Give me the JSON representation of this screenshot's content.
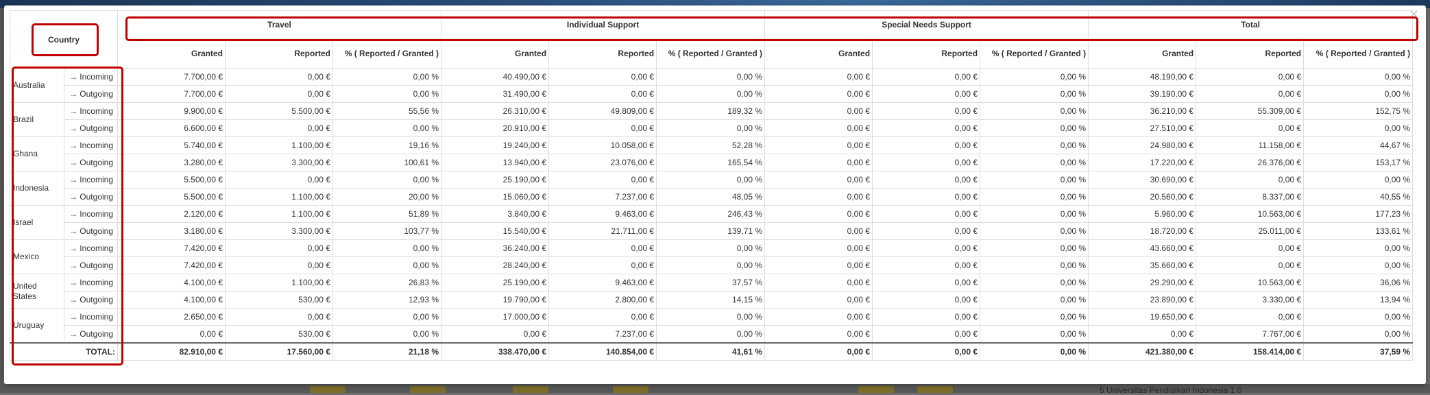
{
  "dialog": {
    "close_icon": "close-icon"
  },
  "table": {
    "corner_label": "Country",
    "groups": [
      "Travel",
      "Individual Support",
      "Special Needs Support",
      "Total"
    ],
    "subcols": [
      "Granted",
      "Reported",
      "% ( Reported / Granted )"
    ],
    "countries": [
      {
        "name": "Australia",
        "rows": [
          {
            "dir": "Incoming",
            "arrow": "right",
            "vals": [
              "7.700,00 €",
              "0,00 €",
              "0,00 %",
              "40.490,00 €",
              "0,00 €",
              "0,00 %",
              "0,00 €",
              "0,00 €",
              "0,00 %",
              "48.190,00 €",
              "0,00 €",
              "0,00 %"
            ]
          },
          {
            "dir": "Outgoing",
            "arrow": "right",
            "vals": [
              "7.700,00 €",
              "0,00 €",
              "0,00 %",
              "31.490,00 €",
              "0,00 €",
              "0,00 %",
              "0,00 €",
              "0,00 €",
              "0,00 %",
              "39.190,00 €",
              "0,00 €",
              "0,00 %"
            ]
          }
        ]
      },
      {
        "name": "Brazil",
        "rows": [
          {
            "dir": "Incoming",
            "arrow": "right",
            "vals": [
              "9.900,00 €",
              "5.500,00 €",
              "55,56 %",
              "26.310,00 €",
              "49.809,00 €",
              "189,32 %",
              "0,00 €",
              "0,00 €",
              "0,00 %",
              "36.210,00 €",
              "55.309,00 €",
              "152,75 %"
            ]
          },
          {
            "dir": "Outgoing",
            "arrow": "right",
            "vals": [
              "6.600,00 €",
              "0,00 €",
              "0,00 %",
              "20.910,00 €",
              "0,00 €",
              "0,00 %",
              "0,00 €",
              "0,00 €",
              "0,00 %",
              "27.510,00 €",
              "0,00 €",
              "0,00 %"
            ]
          }
        ]
      },
      {
        "name": "Ghana",
        "rows": [
          {
            "dir": "Incoming",
            "arrow": "right",
            "vals": [
              "5.740,00 €",
              "1.100,00 €",
              "19,16 %",
              "19.240,00 €",
              "10.058,00 €",
              "52,28 %",
              "0,00 €",
              "0,00 €",
              "0,00 %",
              "24.980,00 €",
              "11.158,00 €",
              "44,67 %"
            ]
          },
          {
            "dir": "Outgoing",
            "arrow": "right",
            "vals": [
              "3.280,00 €",
              "3.300,00 €",
              "100,61 %",
              "13.940,00 €",
              "23.076,00 €",
              "165,54 %",
              "0,00 €",
              "0,00 €",
              "0,00 %",
              "17.220,00 €",
              "26.376,00 €",
              "153,17 %"
            ]
          }
        ]
      },
      {
        "name": "Indonesia",
        "rows": [
          {
            "dir": "Incoming",
            "arrow": "right",
            "vals": [
              "5.500,00 €",
              "0,00 €",
              "0,00 %",
              "25.190,00 €",
              "0,00 €",
              "0,00 %",
              "0,00 €",
              "0,00 €",
              "0,00 %",
              "30.690,00 €",
              "0,00 €",
              "0,00 %"
            ]
          },
          {
            "dir": "Outgoing",
            "arrow": "right",
            "vals": [
              "5.500,00 €",
              "1.100,00 €",
              "20,00 %",
              "15.060,00 €",
              "7.237,00 €",
              "48,05 %",
              "0,00 €",
              "0,00 €",
              "0,00 %",
              "20.560,00 €",
              "8.337,00 €",
              "40,55 %"
            ]
          }
        ]
      },
      {
        "name": "Israel",
        "rows": [
          {
            "dir": "Incoming",
            "arrow": "right",
            "vals": [
              "2.120,00 €",
              "1.100,00 €",
              "51,89 %",
              "3.840,00 €",
              "9.463,00 €",
              "246,43 %",
              "0,00 €",
              "0,00 €",
              "0,00 %",
              "5.960,00 €",
              "10.563,00 €",
              "177,23 %"
            ]
          },
          {
            "dir": "Outgoing",
            "arrow": "right",
            "vals": [
              "3.180,00 €",
              "3.300,00 €",
              "103,77 %",
              "15.540,00 €",
              "21.711,00 €",
              "139,71 %",
              "0,00 €",
              "0,00 €",
              "0,00 %",
              "18.720,00 €",
              "25.011,00 €",
              "133,61 %"
            ]
          }
        ]
      },
      {
        "name": "Mexico",
        "rows": [
          {
            "dir": "Incoming",
            "arrow": "right",
            "vals": [
              "7.420,00 €",
              "0,00 €",
              "0,00 %",
              "36.240,00 €",
              "0,00 €",
              "0,00 %",
              "0,00 €",
              "0,00 €",
              "0,00 %",
              "43.660,00 €",
              "0,00 €",
              "0,00 %"
            ]
          },
          {
            "dir": "Outgoing",
            "arrow": "right",
            "vals": [
              "7.420,00 €",
              "0,00 €",
              "0,00 %",
              "28.240,00 €",
              "0,00 €",
              "0,00 %",
              "0,00 €",
              "0,00 €",
              "0,00 %",
              "35.660,00 €",
              "0,00 €",
              "0,00 %"
            ]
          }
        ]
      },
      {
        "name": "United States",
        "rows": [
          {
            "dir": "Incoming",
            "arrow": "right",
            "vals": [
              "4.100,00 €",
              "1.100,00 €",
              "26,83 %",
              "25.190,00 €",
              "9.463,00 €",
              "37,57 %",
              "0,00 €",
              "0,00 €",
              "0,00 %",
              "29.290,00 €",
              "10.563,00 €",
              "36,06 %"
            ]
          },
          {
            "dir": "Outgoing",
            "arrow": "right",
            "vals": [
              "4.100,00 €",
              "530,00 €",
              "12,93 %",
              "19.790,00 €",
              "2.800,00 €",
              "14,15 %",
              "0,00 €",
              "0,00 €",
              "0,00 %",
              "23.890,00 €",
              "3.330,00 €",
              "13,94 %"
            ]
          }
        ]
      },
      {
        "name": "Uruguay",
        "rows": [
          {
            "dir": "Incoming",
            "arrow": "right",
            "vals": [
              "2.650,00 €",
              "0,00 €",
              "0,00 %",
              "17.000,00 €",
              "0,00 €",
              "0,00 %",
              "0,00 €",
              "0,00 €",
              "0,00 %",
              "19.650,00 €",
              "0,00 €",
              "0,00 %"
            ]
          },
          {
            "dir": "Outgoing",
            "arrow": "right",
            "vals": [
              "0,00 €",
              "530,00 €",
              "0,00 %",
              "0,00 €",
              "7.237,00 €",
              "0,00 %",
              "0,00 €",
              "0,00 €",
              "0,00 %",
              "0,00 €",
              "7.767,00 €",
              "0,00 %"
            ]
          }
        ]
      }
    ],
    "total": {
      "label": "TOTAL:",
      "vals": [
        "82.910,00 €",
        "17.560,00 €",
        "21,18 %",
        "338.470,00 €",
        "140.854,00 €",
        "41,61 %",
        "0,00 €",
        "0,00 €",
        "0,00 %",
        "421.380,00 €",
        "158.414,00 €",
        "37,59 %"
      ]
    }
  },
  "highlight_color": "#c00000",
  "background": {
    "partial_text": "5   Universitas Pendidikan Indonesia    1         0"
  }
}
